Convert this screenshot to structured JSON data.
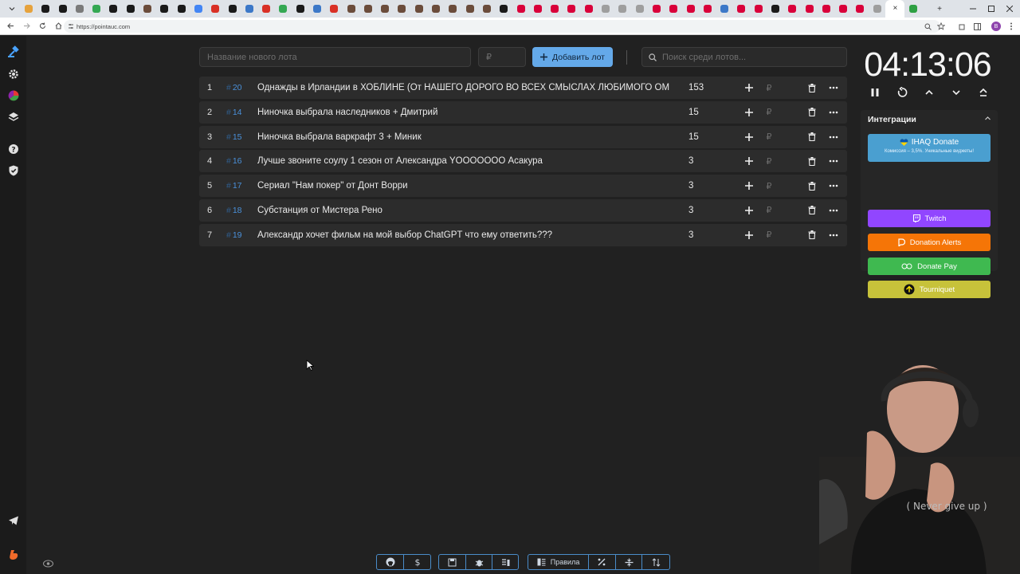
{
  "browser": {
    "url": "https://pointauc.com",
    "profile_initial": "B",
    "tab_favicon_colors": [
      "#e6a23c",
      "#1a1a1a",
      "#1a1a1a",
      "#7a7a7a",
      "#34a853",
      "#1a1a1a",
      "#1a1a1a",
      "#6b4c3b",
      "#1a1a1a",
      "#1a1a1a",
      "#4285f4",
      "#d93025",
      "#1a1a1a",
      "#3c78c8",
      "#d93025",
      "#34a853",
      "#1a1a1a",
      "#3c78c8",
      "#d93025",
      "#6b4c3b",
      "#6b4c3b",
      "#6b4c3b",
      "#6b4c3b",
      "#6b4c3b",
      "#6b4c3b",
      "#6b4c3b",
      "#6b4c3b",
      "#6b4c3b",
      "#1a1a1a",
      "#d9003a",
      "#d9003a",
      "#d9003a",
      "#d9003a",
      "#d9003a",
      "#9e9e9e",
      "#9e9e9e",
      "#9e9e9e",
      "#d9003a",
      "#d9003a",
      "#d9003a",
      "#d9003a",
      "#3c78c8",
      "#d9003a",
      "#d9003a",
      "#1a1a1a",
      "#d9003a",
      "#d9003a",
      "#d9003a",
      "#d9003a",
      "#d9003a",
      "#9e9e9e",
      "#ffffff",
      "#2ea043"
    ],
    "close_tab_icon": "×",
    "new_tab_icon": "+"
  },
  "toolbar": {
    "new_lot_placeholder": "Название нового лота",
    "amount_placeholder": "₽",
    "add_lot_label": "Добавить лот",
    "search_placeholder": "Поиск среди лотов..."
  },
  "lots": [
    {
      "index": "1",
      "id": "20",
      "name": "Однажды в Ирландии в ХОБЛИНЕ (От НАШЕГО ДОРОГО ВО ВСЕХ СМЫСЛАХ ЛЮБИМОГО ОМЕ",
      "amount": "153"
    },
    {
      "index": "2",
      "id": "14",
      "name": "Ниночка выбрала наследников + Дмитрий",
      "amount": "15"
    },
    {
      "index": "3",
      "id": "15",
      "name": "Ниночка выбрала варкрафт 3  + Миник",
      "amount": "15"
    },
    {
      "index": "4",
      "id": "16",
      "name": "Лучше звоните соулу 1 сезон от Александра YOOOOOOO Асакура",
      "amount": "3"
    },
    {
      "index": "5",
      "id": "17",
      "name": "Сериал \"Нам покер\" от Донт Ворри",
      "amount": "3"
    },
    {
      "index": "6",
      "id": "18",
      "name": "Субстанция от Мистера Рено",
      "amount": "3"
    },
    {
      "index": "7",
      "id": "19",
      "name": "Александр хочет фильм на мой выбор ChatGPT что ему ответить???",
      "amount": "3"
    }
  ],
  "lot_hash": "#",
  "currency_symbol": "₽",
  "timer": {
    "value": "04:13:06"
  },
  "integrations": {
    "title": "Интеграции",
    "ihaq": {
      "label": "IHAQ Donate",
      "sub": "Комиссия – 3,5%. Уникальные виджеты!"
    },
    "twitch": "Twitch",
    "donation_alerts": "Donation Alerts",
    "donate_pay": "Donate Pay",
    "tourniquet": "Tourniquet"
  },
  "bottom_bar": {
    "rules_label": "Правила"
  },
  "colors": {
    "accent": "#64a9e9",
    "twitch": "#9146ff",
    "donation_alerts": "#f57507",
    "donate_pay": "#3fb950",
    "tourniquet": "#c7c23a",
    "ihaq": "#4a9fd0"
  }
}
